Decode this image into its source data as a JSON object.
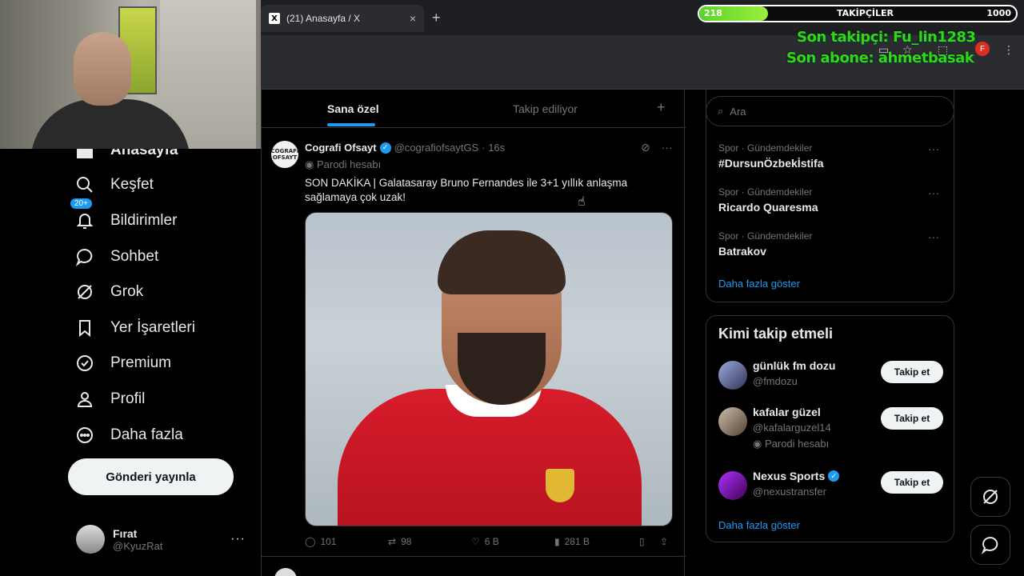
{
  "overlay": {
    "followers_current": "218",
    "followers_goal": "1000",
    "followers_progress": 0.218,
    "followers_label": "TAKİPÇİLER",
    "last_follower": "Son takipçi: Fu_lin1283",
    "last_subscriber": "Son abone: ahmetbasak"
  },
  "browser": {
    "tab_title": "(21) Anasayfa / X",
    "tab_close": "×",
    "new_tab": "+",
    "profile_initial": "F"
  },
  "nav": {
    "home": "Anasayfa",
    "explore": "Keşfet",
    "notifications": "Bildirimler",
    "notifications_badge": "20+",
    "chat": "Sohbet",
    "grok": "Grok",
    "bookmarks": "Yer İşaretleri",
    "premium": "Premium",
    "profile": "Profil",
    "more": "Daha fazla",
    "post_button": "Gönderi yayınla",
    "user_name": "Fırat",
    "user_handle": "@KyuzRat",
    "user_more": "···"
  },
  "timeline": {
    "tab_for_you": "Sana özel",
    "tab_following": "Takip ediliyor",
    "tab_add": "+"
  },
  "tweet": {
    "avatar_text": "COGRAFI OFSAYT",
    "name": "Cografi Ofsayt",
    "handle": "@cografiofsaytGS",
    "time": "· 16s",
    "parody": "Parodi hesabı",
    "text": "SON DAKİKA | Galatasaray Bruno Fernandes ile 3+1 yıllık anlaşma sağlamaya çok uzak!",
    "replies": "101",
    "reposts": "98",
    "likes": "6 B",
    "views": "281 B"
  },
  "sidebar": {
    "search_placeholder": "Ara",
    "trends": [
      {
        "category": "Spor · Gündemdekiler",
        "name": "#DursunÖzbekİstifa"
      },
      {
        "category": "Spor · Gündemdekiler",
        "name": "Ricardo Quaresma"
      },
      {
        "category": "Spor · Gündemdekiler",
        "name": "Batrakov"
      }
    ],
    "trends_more_dots": "···",
    "show_more": "Daha fazla göster",
    "who_to_follow_title": "Kimi takip etmeli",
    "who_to_follow": [
      {
        "name": "günlük fm dozu",
        "handle": "@fmdozu",
        "extra": "",
        "button": "Takip et"
      },
      {
        "name": "kafalar güzel",
        "handle": "@kafalarguzel14",
        "extra": "Parodi hesabı",
        "button": "Takip et"
      },
      {
        "name": "Nexus Sports",
        "handle": "@nexustransfer",
        "extra": "",
        "button": "Takip et"
      }
    ],
    "wtf_show_more": "Daha fazla göster"
  },
  "colors": {
    "accent": "#1d9bf0",
    "background": "#000000",
    "overlay_green": "#33d61b"
  }
}
